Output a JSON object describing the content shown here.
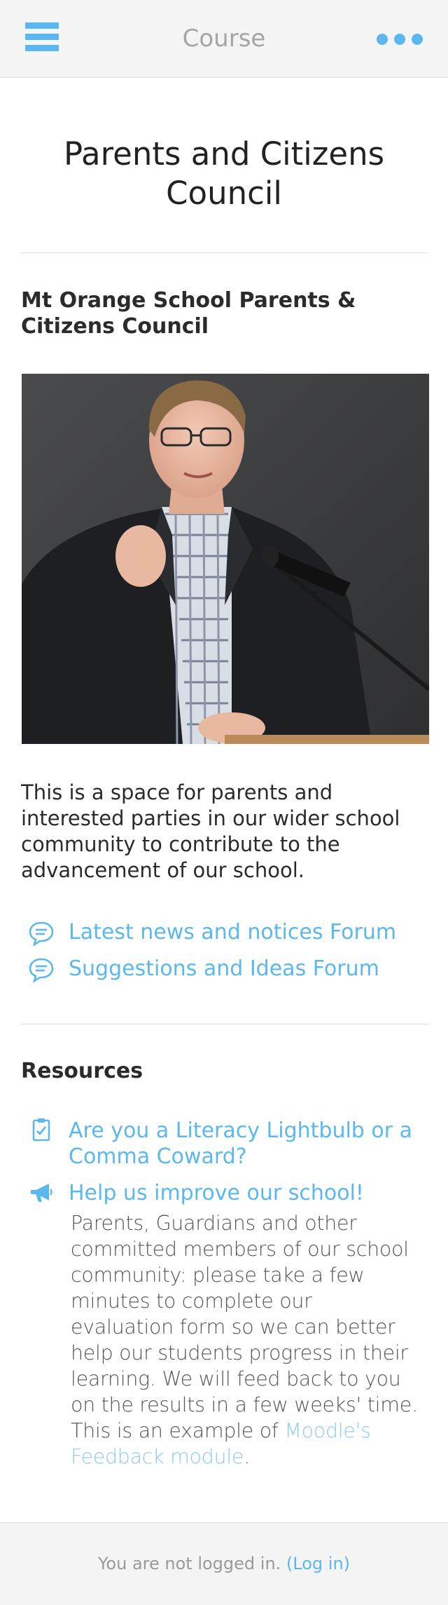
{
  "header": {
    "title": "Course",
    "menu_icon": "hamburger-menu-icon",
    "more_icon": "more-options-icon",
    "accent_color": "#5bb8ee"
  },
  "page": {
    "title": "Parents and Citizens Council"
  },
  "section": {
    "title": "Mt Orange School Parents & Citizens Council",
    "image_subject": "photo",
    "summary": "This is a space for parents and interested parties in our wider school community to contribute to the advancement of our school."
  },
  "activities": [
    {
      "label": "Latest news and notices Forum",
      "icon": "forum-icon"
    },
    {
      "label": "Suggestions and Ideas Forum",
      "icon": "forum-icon"
    }
  ],
  "resources": {
    "title": "Resources",
    "items": [
      {
        "label": "Are you a Literacy Lightbulb or a Comma Coward?",
        "icon": "quiz-icon"
      },
      {
        "label": "Help us improve our school!",
        "icon": "feedback-megaphone-icon"
      }
    ],
    "feedback_description": "Parents, Guardians and other committed members of our school community: please take a few minutes to complete our evaluation form so we can better help our students progress in their learning. We will feed back to you on the results in a few weeks' time. This is an example of ",
    "feedback_link": "Moodle's Feedback module",
    "feedback_end": "."
  },
  "footer": {
    "text": "You are not logged in. ",
    "login_link": "(Log in)"
  }
}
